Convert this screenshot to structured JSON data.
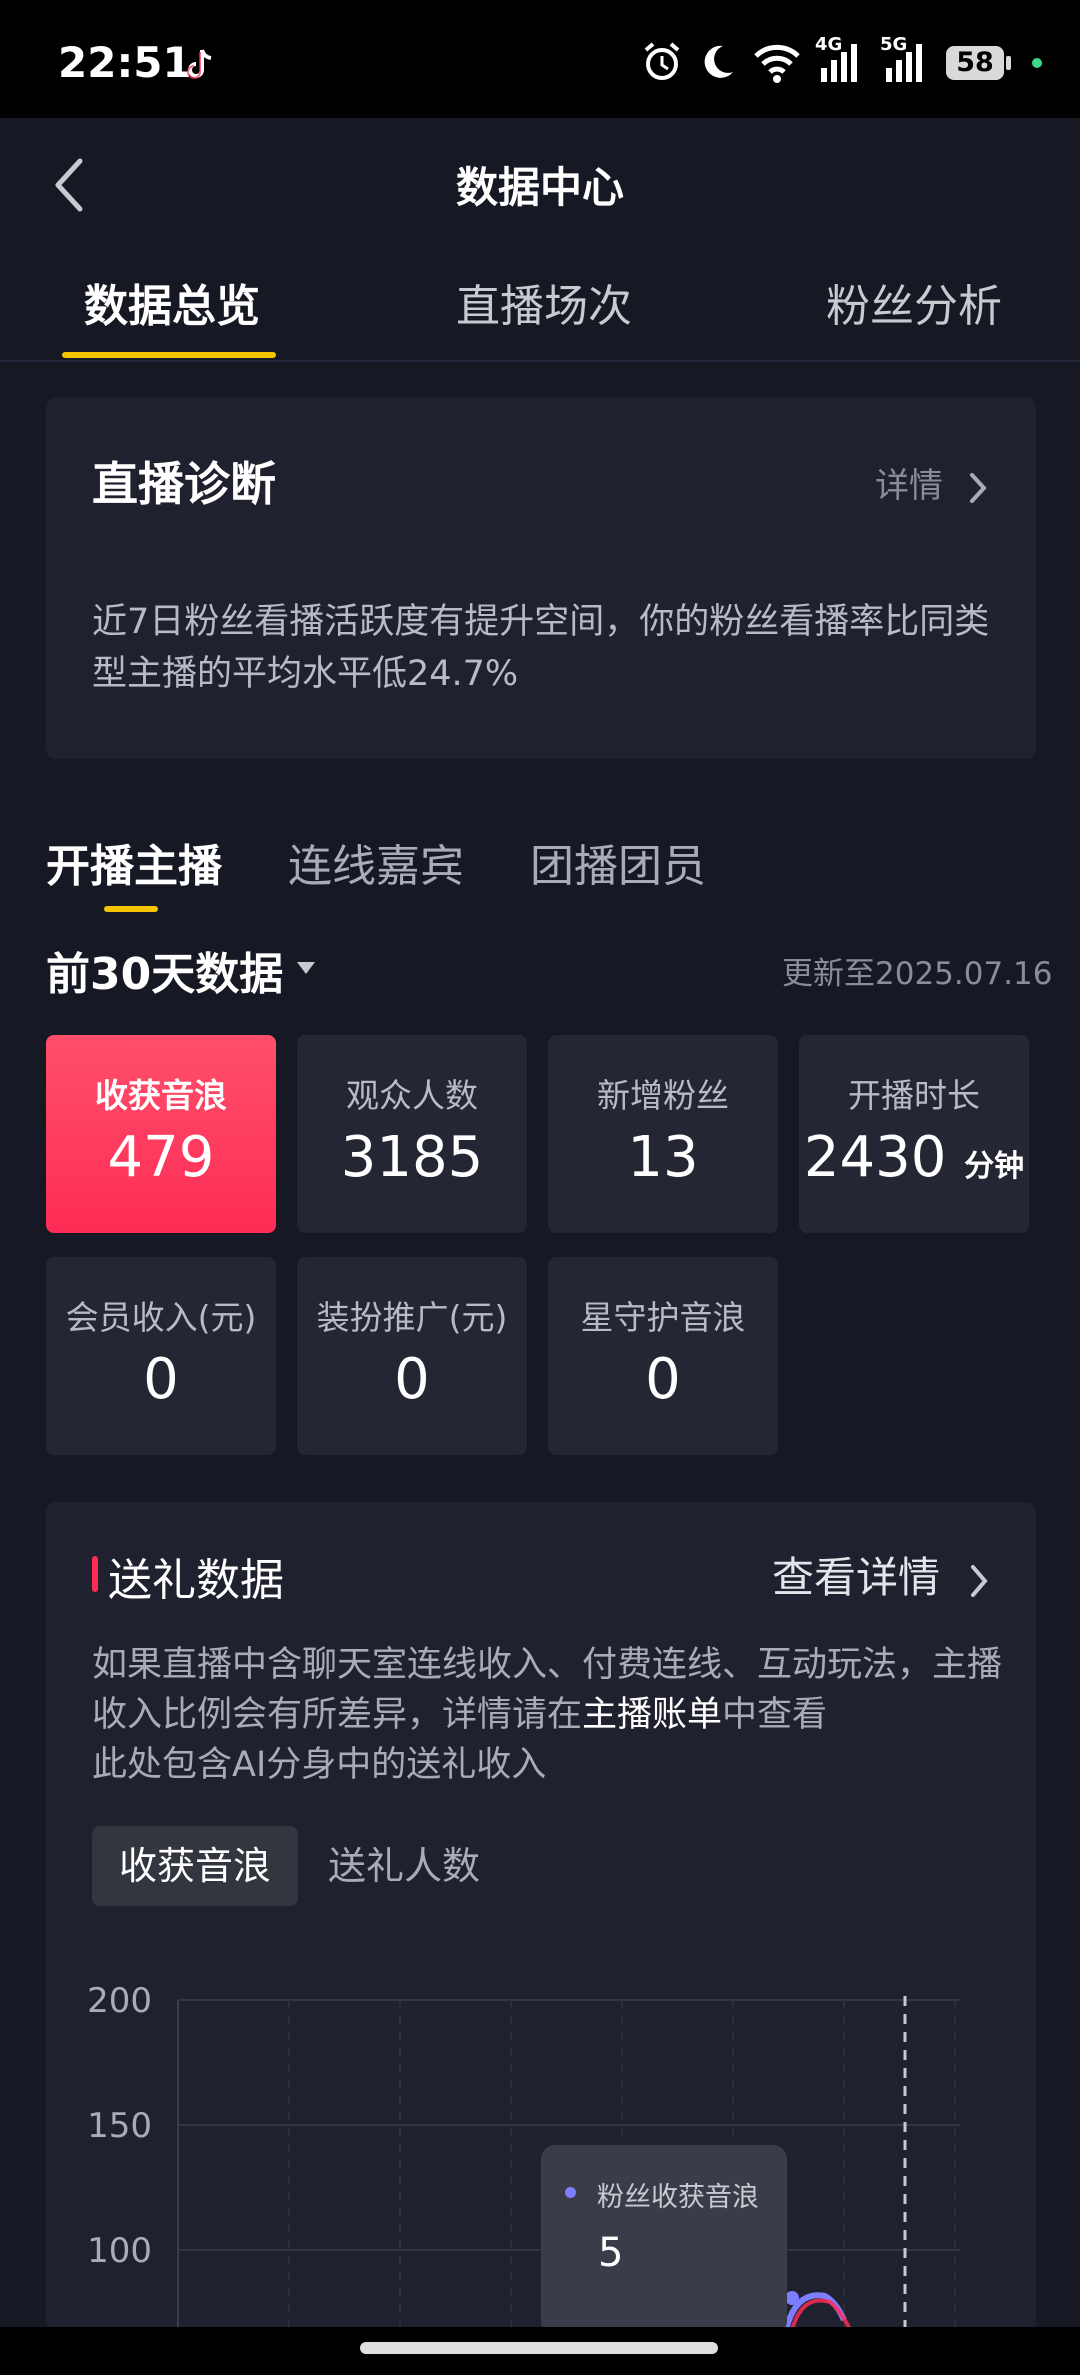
{
  "status_bar": {
    "time": "22:51",
    "battery": "58",
    "net1": "4G",
    "net2": "5G"
  },
  "header": {
    "title": "数据中心"
  },
  "tabs": [
    {
      "label": "数据总览",
      "active": true
    },
    {
      "label": "直播场次",
      "active": false
    },
    {
      "label": "粉丝分析",
      "active": false
    }
  ],
  "diagnosis": {
    "title": "直播诊断",
    "detail_label": "详情",
    "text": "近7日粉丝看播活跃度有提升空间，你的粉丝看播率比同类型主播的平均水平低24.7%"
  },
  "subtabs": [
    {
      "label": "开播主播",
      "active": true
    },
    {
      "label": "连线嘉宾",
      "active": false
    },
    {
      "label": "团播团员",
      "active": false
    }
  ],
  "period": {
    "label": "前30天数据",
    "updated": "更新至2025.07.16"
  },
  "stats": [
    {
      "label": "收获音浪",
      "value": "479",
      "unit": "",
      "selected": true
    },
    {
      "label": "观众人数",
      "value": "3185",
      "unit": ""
    },
    {
      "label": "新增粉丝",
      "value": "13",
      "unit": ""
    },
    {
      "label": "开播时长",
      "value": "2430",
      "unit": "分钟"
    },
    {
      "label": "会员收入(元)",
      "value": "0",
      "unit": ""
    },
    {
      "label": "装扮推广(元)",
      "value": "0",
      "unit": ""
    },
    {
      "label": "星守护音浪",
      "value": "0",
      "unit": ""
    }
  ],
  "gift": {
    "title": "送礼数据",
    "more_label": "查看详情",
    "note_1": "如果直播中含聊天室连线收入、付费连线、互动玩法，主播收入比例会有所差异，详情请在",
    "note_link": "主播账单",
    "note_2": "中查看",
    "note_3": "此处包含AI分身中的送礼收入",
    "segments": [
      {
        "label": "收获音浪",
        "active": true
      },
      {
        "label": "送礼人数",
        "active": false
      }
    ]
  },
  "chart_data": {
    "type": "line",
    "y_ticks": [
      "200",
      "150",
      "100"
    ],
    "ylim": [
      0,
      200
    ],
    "grid": true,
    "tooltip": {
      "series": "粉丝收获音浪",
      "value": "5"
    },
    "colors": {
      "series_1": "#7d7dff",
      "series_2": "#fe2c55"
    }
  }
}
